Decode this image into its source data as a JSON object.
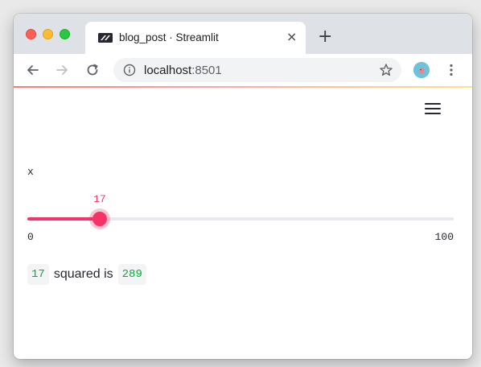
{
  "browser": {
    "tab": {
      "title": "blog_post · Streamlit",
      "close": "×"
    },
    "new_tab": "+",
    "address": {
      "host": "localhost",
      "port": ":8501"
    }
  },
  "app": {
    "slider": {
      "label": "x",
      "value": 17,
      "value_text": "17",
      "min": 0,
      "min_text": "0",
      "max": 100,
      "max_text": "100"
    },
    "result": {
      "input": "17",
      "text": "squared is",
      "output": "289"
    }
  },
  "colors": {
    "accent": "#f63366",
    "code_text": "#09ab3b",
    "tab_bar": "#dee1e6"
  },
  "icons": [
    "streamlit-favicon-icon",
    "back-arrow-icon",
    "forward-arrow-icon",
    "reload-icon",
    "info-icon",
    "star-icon",
    "profile-avatar-icon",
    "kebab-menu-icon",
    "hamburger-menu-icon"
  ]
}
